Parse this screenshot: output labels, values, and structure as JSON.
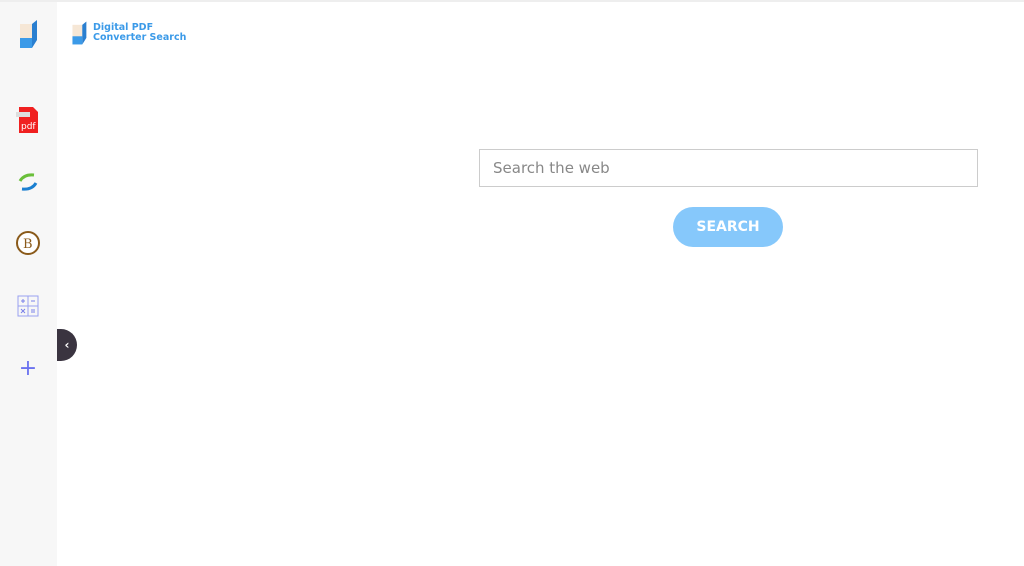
{
  "brand": {
    "line1": "Digital PDF",
    "line2": "Converter Search"
  },
  "sidebar": {
    "items": [
      {
        "name": "pdf-converter",
        "icon": "pdf-logo-icon"
      },
      {
        "name": "pdf",
        "icon": "pdf-icon",
        "label": "pdf"
      },
      {
        "name": "exchange",
        "icon": "sync-arrows-icon"
      },
      {
        "name": "bitcoin",
        "icon": "bitcoin-icon",
        "label": "B"
      },
      {
        "name": "calculator",
        "icon": "calculator-icon"
      },
      {
        "name": "add",
        "icon": "plus-icon",
        "label": "+"
      }
    ]
  },
  "search": {
    "placeholder": "Search the web",
    "value": "",
    "button_label": "SEARCH"
  },
  "colors": {
    "accent": "#86c8fb",
    "brand": "#3b9ae8"
  }
}
